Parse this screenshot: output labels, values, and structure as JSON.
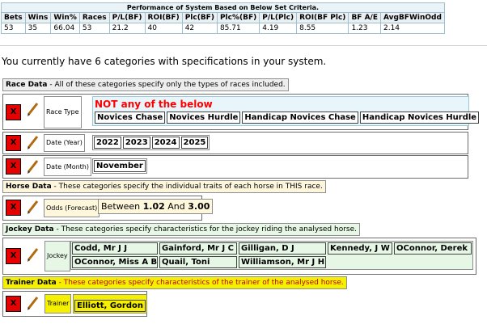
{
  "performance": {
    "caption": "Performance of System Based on Below Set Criteria.",
    "headers": [
      "Bets",
      "Wins",
      "Win%",
      "Races",
      "P/L(BF)",
      "ROI(BF)",
      "Plc(BF)",
      "Plc%(BF)",
      "P/L(Plc)",
      "ROI(BF Plc)",
      "BF A/E",
      "AvgBFWinOdd"
    ],
    "values": [
      "53",
      "35",
      "66.04",
      "53",
      "21.2",
      "40",
      "42",
      "85.71",
      "4.19",
      "8.55",
      "1.23",
      "2.14"
    ]
  },
  "summary_text": "You currently have 6 categories with specifications in your system.",
  "sections": {
    "race": {
      "title": "Race Data",
      "desc": " - All of these categories specify only the types of races included."
    },
    "horse": {
      "title": "Horse Data",
      "desc": " - These categories specify the individual traits of each horse in THIS race."
    },
    "jockey": {
      "title": "Jockey Data",
      "desc": " - These categories specify characteristics for the jockey riding the analysed horse."
    },
    "trainer": {
      "title": "Trainer Data",
      "desc": " - These categories specify characteristics of the trainer of the analysed horse."
    }
  },
  "delete_label": "X",
  "rows": {
    "race_type": {
      "label": "Race Type",
      "condition": "NOT any of the below",
      "values": [
        "Novices Chase",
        "Novices Hurdle",
        "Handicap Novices Chase",
        "Handicap Novices Hurdle"
      ]
    },
    "date_year": {
      "label": "Date (Year)",
      "values": [
        "2022",
        "2023",
        "2024",
        "2025"
      ]
    },
    "date_month": {
      "label": "Date (Month)",
      "values": [
        "November"
      ]
    },
    "odds": {
      "label": "Odds (Forecast)",
      "prefix": "Between",
      "low": "1.02",
      "mid": "And",
      "high": "3.00"
    },
    "jockey": {
      "label": "Jockey",
      "values": [
        "Codd, Mr J J",
        "Gainford, Mr J C",
        "Gilligan, D J",
        "Kennedy, J W",
        "OConnor, Derek",
        "OConnor, Miss A B",
        "Quail, Toni",
        "Williamson, Mr J H"
      ]
    },
    "trainer": {
      "label": "Trainer",
      "values": [
        "Elliott, Gordon"
      ]
    }
  },
  "colors": {
    "delete": "#e60000",
    "race_title": "#ff0000",
    "trainer": "#f5f000"
  }
}
